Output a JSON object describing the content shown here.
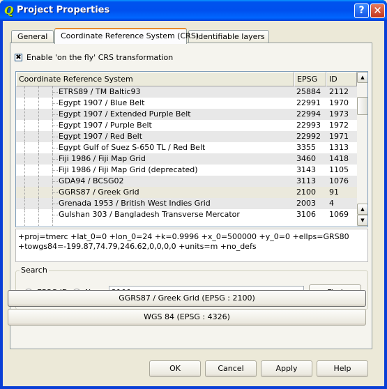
{
  "window": {
    "title": "Project Properties",
    "app_icon": "qgis-icon",
    "help_glyph": "?",
    "close_glyph": "✕"
  },
  "tabs": [
    {
      "label": "General",
      "active": false
    },
    {
      "label": "Coordinate Reference System (CRS)",
      "active": true
    },
    {
      "label": "Identifiable layers",
      "active": false
    }
  ],
  "otf": {
    "label": "Enable 'on the fly' CRS transformation",
    "checked": true,
    "glyph": "✖"
  },
  "crs_tree": {
    "columns": [
      "Coordinate Reference System",
      "EPSG",
      "ID"
    ],
    "rows": [
      {
        "name": "ETRS89 / TM Baltic93",
        "epsg": "25884",
        "id": "2112"
      },
      {
        "name": "Egypt 1907 / Blue Belt",
        "epsg": "22991",
        "id": "1970"
      },
      {
        "name": "Egypt 1907 / Extended Purple Belt",
        "epsg": "22994",
        "id": "1973"
      },
      {
        "name": "Egypt 1907 / Purple Belt",
        "epsg": "22993",
        "id": "1972"
      },
      {
        "name": "Egypt 1907 / Red Belt",
        "epsg": "22992",
        "id": "1971"
      },
      {
        "name": "Egypt Gulf of Suez S-650 TL / Red Belt",
        "epsg": "3355",
        "id": "1313"
      },
      {
        "name": "Fiji 1986 / Fiji Map Grid",
        "epsg": "3460",
        "id": "1418"
      },
      {
        "name": "Fiji 1986 / Fiji Map Grid (deprecated)",
        "epsg": "3143",
        "id": "1105"
      },
      {
        "name": "GDA94 / BCSG02",
        "epsg": "3113",
        "id": "1076"
      },
      {
        "name": "GGRS87 / Greek Grid",
        "epsg": "2100",
        "id": "91",
        "selected": true
      },
      {
        "name": "Grenada 1953 / British West Indies Grid",
        "epsg": "2003",
        "id": "4"
      },
      {
        "name": "Gulshan 303 / Bangladesh Transverse Mercator",
        "epsg": "3106",
        "id": "1069"
      }
    ],
    "scroll_up_glyph": "▲",
    "scroll_down_glyph": "▼"
  },
  "proj_string": "+proj=tmerc +lat_0=0 +lon_0=24 +k=0.9996 +x_0=500000 +y_0=0 +ellps=GRS80\n+towgs84=-199.87,74.79,246.62,0,0,0,0 +units=m +no_defs",
  "search": {
    "group_label": "Search",
    "radio_epsg": "EPSG ID",
    "radio_name": "Name",
    "selected_mode": "EPSG ID",
    "value": "2100",
    "find_label": "Find"
  },
  "recent_crs": [
    "GGRS87 / Greek Grid (EPSG : 2100)",
    "WGS 84 (EPSG : 4326)"
  ],
  "buttons": {
    "ok": "OK",
    "cancel": "Cancel",
    "apply": "Apply",
    "help": "Help"
  }
}
